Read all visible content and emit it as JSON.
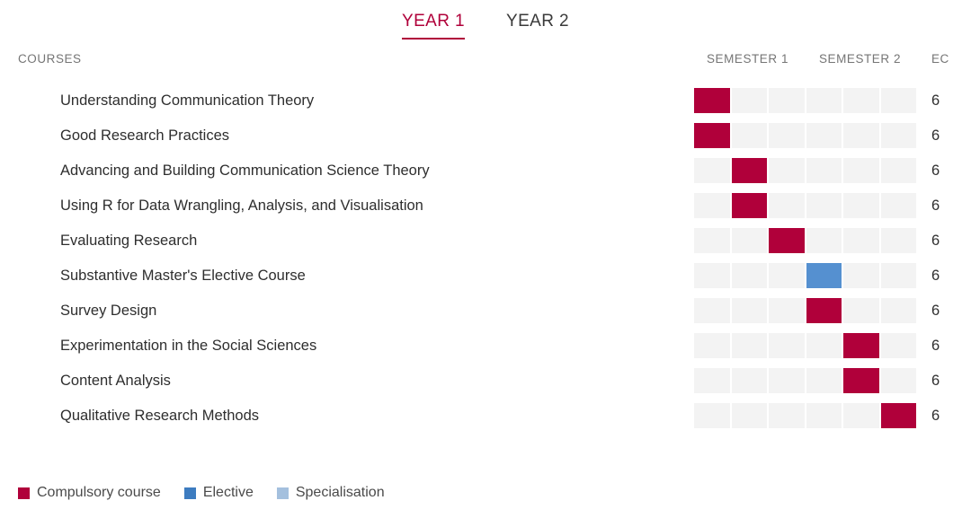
{
  "tabs": [
    {
      "label": "YEAR 1",
      "active": true
    },
    {
      "label": "YEAR 2",
      "active": false
    }
  ],
  "columns": {
    "courses": "COURSES",
    "semester_1": "SEMESTER 1",
    "semester_2": "SEMESTER 2",
    "ec": "EC"
  },
  "colors": {
    "compulsory": "#b0003a",
    "elective": "#5590d0",
    "specialisation": "#a4c0de",
    "cell_empty": "#f3f3f3",
    "accent": "#b0003a"
  },
  "grid": {
    "blocks": 6,
    "blocks_per_semester": 3
  },
  "courses": [
    {
      "name": "Understanding Communication Theory",
      "ec": "6",
      "block": 0,
      "type": "compulsory"
    },
    {
      "name": "Good Research Practices",
      "ec": "6",
      "block": 0,
      "type": "compulsory"
    },
    {
      "name": "Advancing and Building Communication Science Theory",
      "ec": "6",
      "block": 1,
      "type": "compulsory"
    },
    {
      "name": "Using R for Data Wrangling, Analysis, and Visualisation",
      "ec": "6",
      "block": 1,
      "type": "compulsory"
    },
    {
      "name": "Evaluating Research",
      "ec": "6",
      "block": 2,
      "type": "compulsory"
    },
    {
      "name": "Substantive Master's Elective Course",
      "ec": "6",
      "block": 3,
      "type": "elective"
    },
    {
      "name": "Survey Design",
      "ec": "6",
      "block": 3,
      "type": "compulsory"
    },
    {
      "name": "Experimentation in the Social Sciences",
      "ec": "6",
      "block": 4,
      "type": "compulsory"
    },
    {
      "name": "Content Analysis",
      "ec": "6",
      "block": 4,
      "type": "compulsory"
    },
    {
      "name": "Qualitative Research Methods",
      "ec": "6",
      "block": 5,
      "type": "compulsory"
    }
  ],
  "legend": [
    {
      "label": "Compulsory course",
      "type": "compulsory"
    },
    {
      "label": "Elective",
      "type": "elective"
    },
    {
      "label": "Specialisation",
      "type": "special"
    }
  ]
}
